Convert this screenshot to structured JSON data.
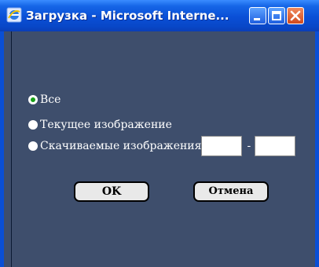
{
  "window": {
    "title": "Загрузка - Microsoft Interne..."
  },
  "options": [
    {
      "label": "Все",
      "checked": true
    },
    {
      "label": "Текущее изображение",
      "checked": false
    },
    {
      "label": "Скачиваемые изображения",
      "checked": false
    }
  ],
  "range": {
    "from_value": "",
    "to_value": "",
    "separator": "-"
  },
  "buttons": {
    "ok": "OK",
    "cancel": "Отмена"
  },
  "colors": {
    "titlebar": "#0a4fd6",
    "client_bg": "#3e4e6c",
    "radio_dot": "#18a018"
  }
}
